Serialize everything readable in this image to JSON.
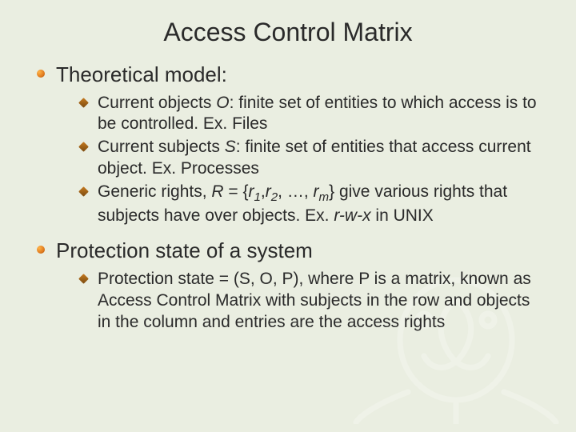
{
  "title": "Access Control Matrix",
  "sections": [
    {
      "heading": "Theoretical model:",
      "items": [
        {
          "pre": "Current objects ",
          "var": "O",
          "post": ": finite set of entities to which access is to be controlled. Ex. Files"
        },
        {
          "pre": "Current subjects ",
          "var": "S",
          "post": ": finite set of entities that access current object. Ex. Processes"
        },
        {
          "pre": "Generic rights, ",
          "var": "R",
          "eq_pre": " = {",
          "r1": "r",
          "s1": "1",
          "comma1": ",",
          "r2": "r",
          "s2": "2",
          "mid": ", …, ",
          "rm": "r",
          "sm": "m",
          "eq_post": "}",
          "post": " give various rights that subjects have over objects. Ex. ",
          "ex": "r-w-x",
          "post2": " in UNIX"
        }
      ]
    },
    {
      "heading": "Protection state of a system",
      "items": [
        {
          "text": "Protection state = (S, O, P), where P is a matrix, known as Access Control Matrix with subjects in the row and objects in the column and entries are the access rights"
        }
      ]
    }
  ]
}
